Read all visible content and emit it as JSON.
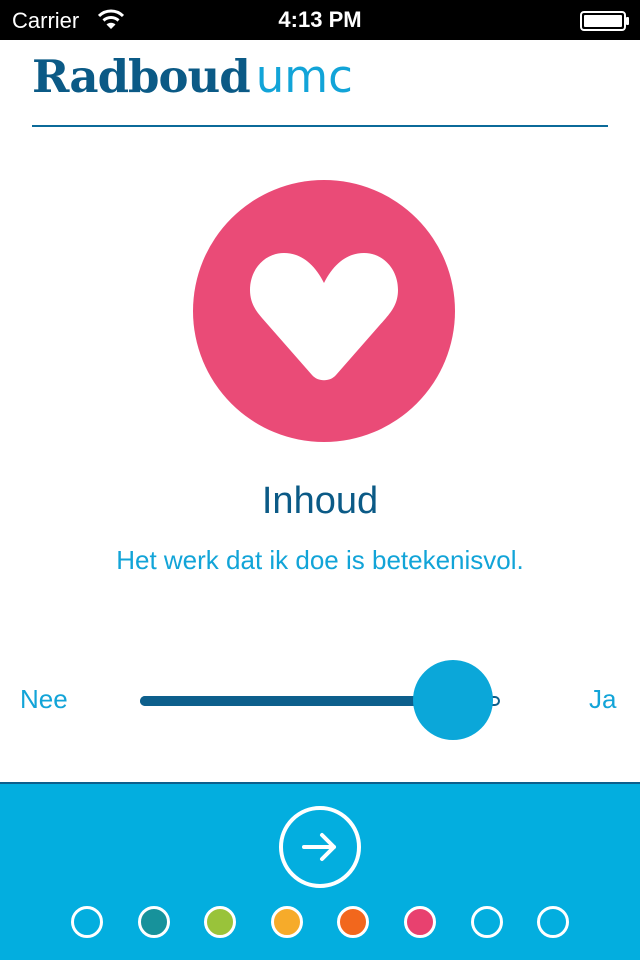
{
  "status_bar": {
    "carrier": "Carrier",
    "time": "4:13 PM"
  },
  "header": {
    "logo_part1": "Radboud",
    "logo_part2": "umc"
  },
  "topic": {
    "title": "Inhoud",
    "statement": "Het werk dat ik doe is betekenisvol.",
    "icon": "heart-icon",
    "color": "#ea4b77"
  },
  "scale": {
    "min_label": "Nee",
    "max_label": "Ja",
    "value": 0.87
  },
  "navigation": {
    "next_icon": "arrow-right-icon",
    "dots": [
      {
        "color": "transparent",
        "state": "empty"
      },
      {
        "color": "#17929b",
        "state": "done"
      },
      {
        "color": "#99c33a",
        "state": "done"
      },
      {
        "color": "#f6ab2a",
        "state": "done"
      },
      {
        "color": "#f2671d",
        "state": "done"
      },
      {
        "color": "#e8416f",
        "state": "current"
      },
      {
        "color": "transparent",
        "state": "empty"
      },
      {
        "color": "transparent",
        "state": "empty"
      }
    ]
  },
  "colors": {
    "brand_dark": "#0b5a86",
    "brand_light": "#12a4d8",
    "panel": "#03aedf"
  }
}
